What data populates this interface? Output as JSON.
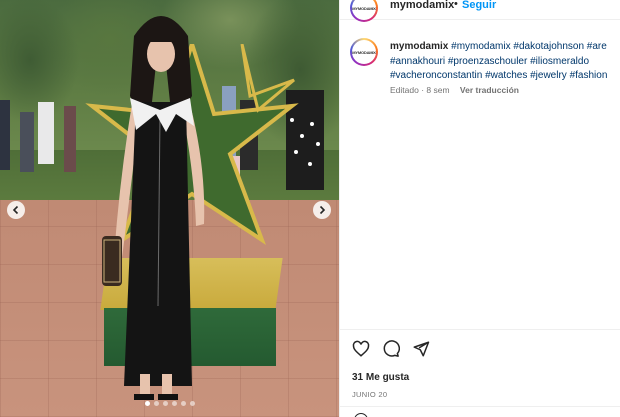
{
  "post": {
    "username": "mymodamix",
    "separator": "•",
    "follow_label": "Seguir",
    "avatar_logo_text": "MYMODAMIX"
  },
  "caption": {
    "author": "mymodamix",
    "hashtags": [
      "#mymodamix",
      "#dakotajohnson",
      "#are",
      "#annakhouri",
      "#proenzaschouler",
      "#iliosmeraldo",
      "#vacheronconstantin",
      "#watches",
      "#jewelry",
      "#fashion"
    ],
    "edited": "Editado · 8 sem",
    "translate_label": "Ver traducción"
  },
  "stats": {
    "likes": "31 Me gusta",
    "date": "JUNIO 20"
  },
  "carousel": {
    "dot_count": 6,
    "active_index": 0
  },
  "icons": {
    "like": "heart-icon",
    "comment": "comment-bubble-icon",
    "share": "paper-plane-icon",
    "prev": "chevron-left-icon",
    "next": "chevron-right-icon"
  },
  "colors": {
    "link": "#00376b",
    "follow": "#0095f6",
    "muted": "#737373",
    "text": "#262626"
  }
}
